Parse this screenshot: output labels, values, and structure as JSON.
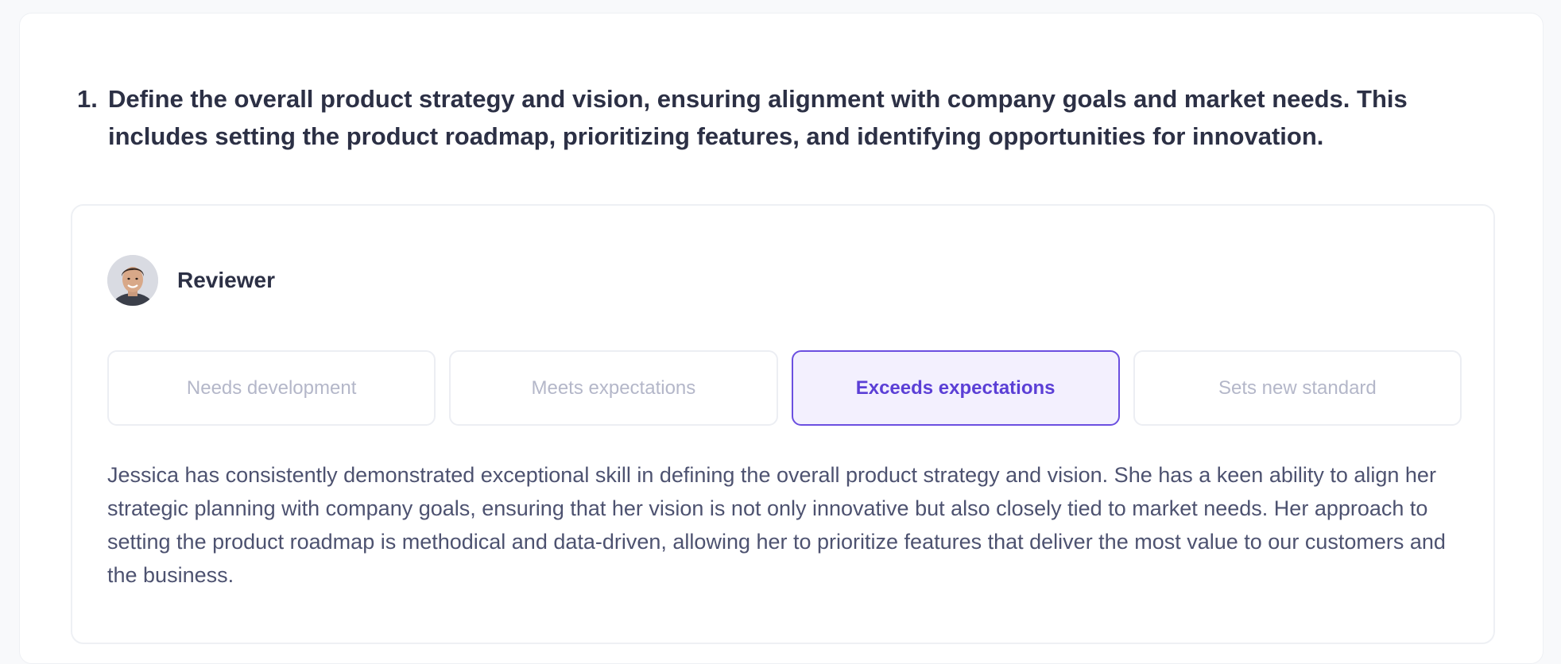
{
  "question": {
    "number": "1.",
    "text": "Define the overall product strategy and vision, ensuring alignment with company goals and market needs. This includes setting the product roadmap, prioritizing features, and identifying opportunities for innovation."
  },
  "review": {
    "reviewer_label": "Reviewer",
    "ratings": [
      {
        "label": "Needs development",
        "selected": false
      },
      {
        "label": "Meets expectations",
        "selected": false
      },
      {
        "label": "Exceeds expectations",
        "selected": true
      },
      {
        "label": "Sets new standard",
        "selected": false
      }
    ],
    "comment": "Jessica has consistently demonstrated exceptional skill in defining the overall product strategy and vision. She has a keen ability to align her strategic planning with company goals, ensuring that her vision is not only innovative but also closely tied to market needs. Her approach to setting the product roadmap is methodical and data-driven, allowing her to prioritize features that deliver the most value to our customers and the business."
  },
  "colors": {
    "accent": "#6b4fe0",
    "accent_bg": "#f3f0fe",
    "muted_text": "#b4b7c9"
  }
}
